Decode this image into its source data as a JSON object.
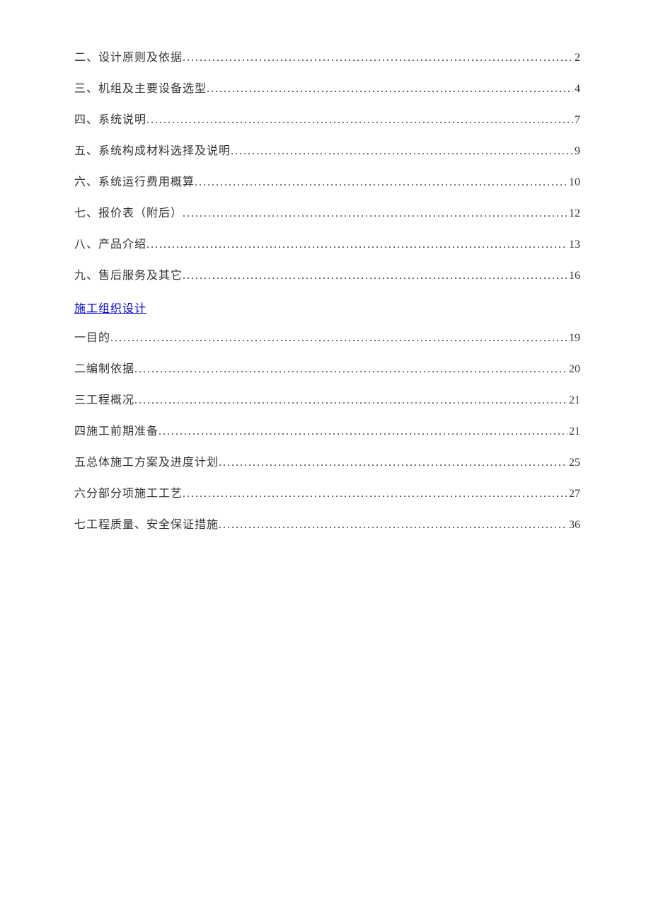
{
  "toc": {
    "part1": [
      {
        "title": "二、设计原则及依据",
        "page": "2"
      },
      {
        "title": "三、机组及主要设备选型",
        "page": "4"
      },
      {
        "title": "四、系统说明",
        "page": "7"
      },
      {
        "title": "五、系统构成材料选择及说明",
        "page": "9"
      },
      {
        "title": "六、系统运行费用概算",
        "page": "10"
      },
      {
        "title": "七、报价表（附后）",
        "page": "12"
      },
      {
        "title": "八、产品介绍",
        "page": "13"
      },
      {
        "title": "九、售后服务及其它",
        "page": "16"
      }
    ],
    "section_link": "施工组织设计",
    "part2": [
      {
        "title": "一目的",
        "page": "19"
      },
      {
        "title": "二编制依据",
        "page": "20"
      },
      {
        "title": "三工程概况",
        "page": "21"
      },
      {
        "title": "四施工前期准备",
        "page": "21"
      },
      {
        "title": "五总体施工方案及进度计划",
        "page": "25"
      },
      {
        "title": "六分部分项施工工艺",
        "page": "27"
      },
      {
        "title": "七工程质量、安全保证措施",
        "page": "36"
      }
    ]
  }
}
